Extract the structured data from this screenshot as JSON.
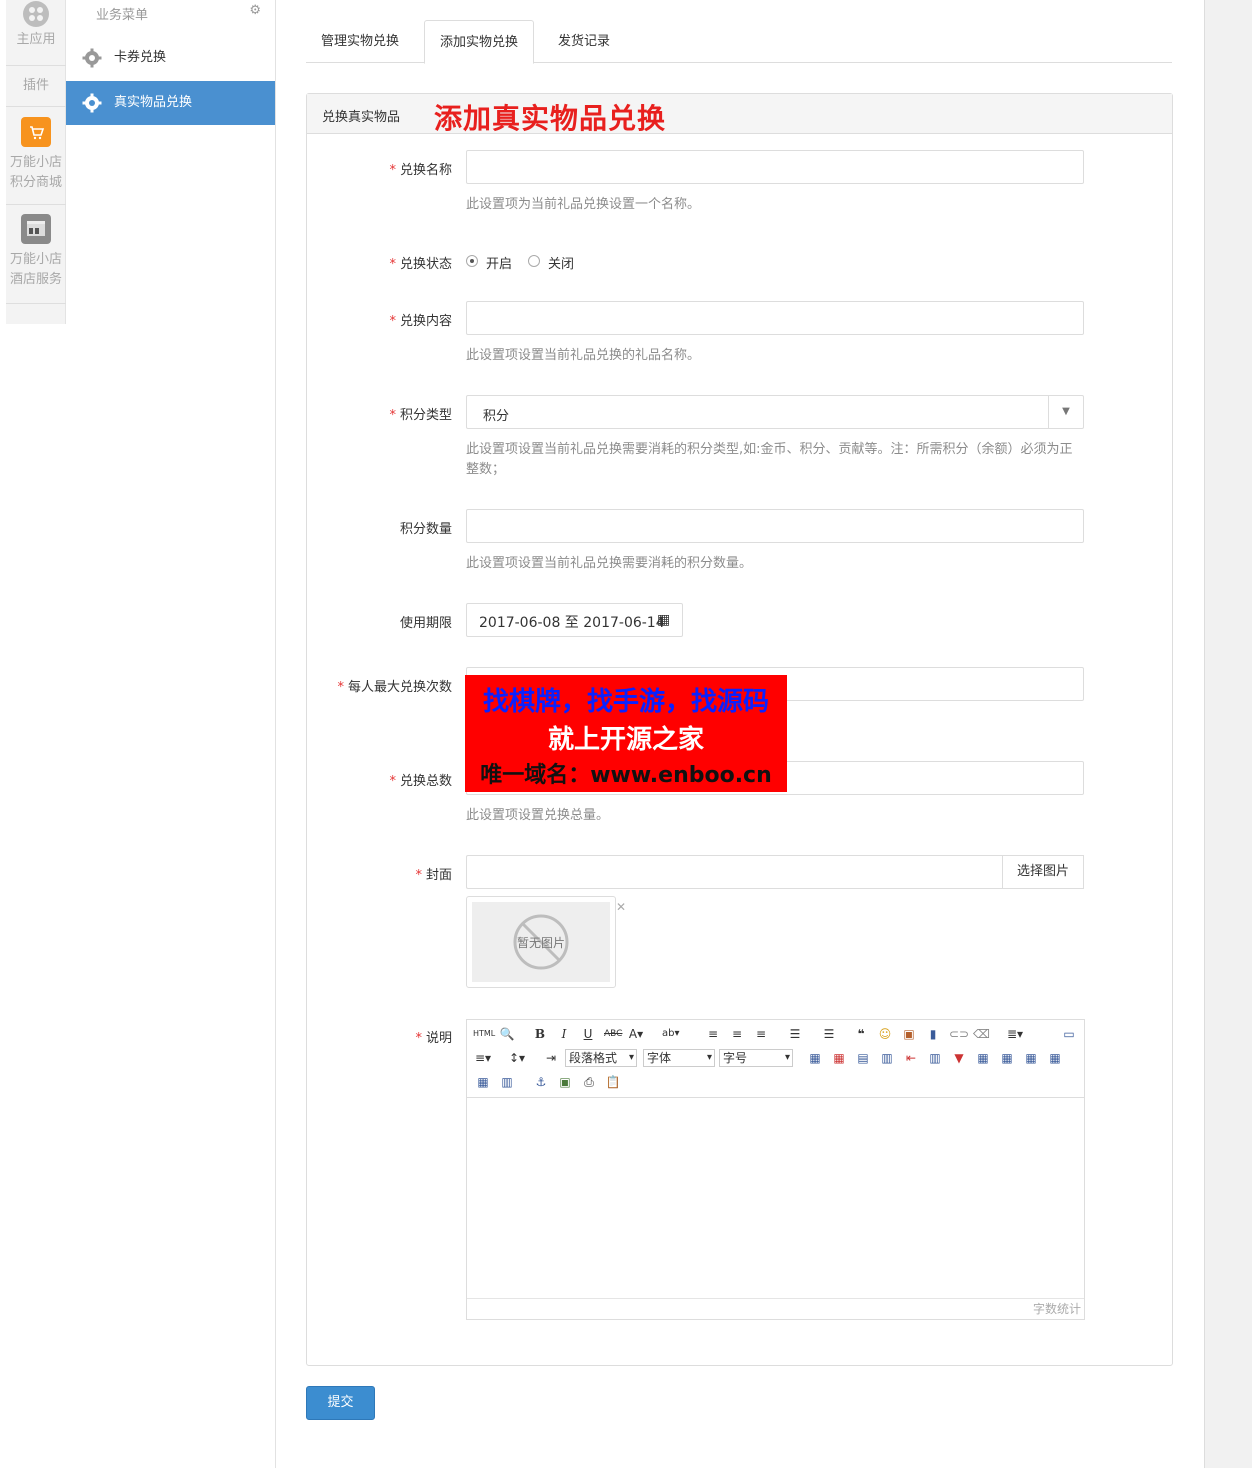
{
  "rail": {
    "items": [
      {
        "label": "主应用"
      },
      {
        "label": "插件"
      },
      {
        "label": "万能小店积分商城",
        "line1": "万能小店",
        "line2": "积分商城"
      },
      {
        "label": "万能小店酒店服务",
        "line1": "万能小店",
        "line2": "酒店服务"
      }
    ]
  },
  "menu": {
    "title": "业务菜单",
    "items": [
      {
        "label": "卡券兑换"
      },
      {
        "label": "真实物品兑换"
      }
    ]
  },
  "tabs": [
    {
      "label": "管理实物兑换"
    },
    {
      "label": "添加实物兑换"
    },
    {
      "label": "发货记录"
    }
  ],
  "panel": {
    "title": "兑换真实物品",
    "overlay_title": "添加真实物品兑换"
  },
  "form": {
    "name_label": "兑换名称",
    "name_help": "此设置项为当前礼品兑换设置一个名称。",
    "status_label": "兑换状态",
    "status_on": "开启",
    "status_off": "关闭",
    "content_label": "兑换内容",
    "content_help": "此设置项设置当前礼品兑换的礼品名称。",
    "credit_type_label": "积分类型",
    "credit_type_value": "积分",
    "credit_type_help": "此设置项设置当前礼品兑换需要消耗的积分类型,如:金币、积分、贡献等。注：所需积分（余额）必须为正整数；",
    "credit_amount_label": "积分数量",
    "credit_amount_help": "此设置项设置当前礼品兑换需要消耗的积分数量。",
    "period_label": "使用期限",
    "period_value": "2017-06-08 至 2017-06-14",
    "max_per_user_label": "每人最大兑换次数",
    "total_label": "兑换总数",
    "total_help": "此设置项设置兑换总量。",
    "cover_label": "封面",
    "cover_button": "选择图片",
    "cover_placeholder": "暂无图片",
    "desc_label": "说明"
  },
  "editor": {
    "paragraph": "段落格式",
    "font": "字体",
    "size": "字号",
    "word_count": "字数统计"
  },
  "ad": {
    "line1": "找棋牌，找手游，找源码",
    "line2": "就上开源之家",
    "line3": "唯一域名：www.enboo.cn"
  },
  "submit_label": "提交",
  "colors": {
    "accent": "#4a90d0",
    "required": "#e53333",
    "overlay_red": "#e8201e"
  }
}
